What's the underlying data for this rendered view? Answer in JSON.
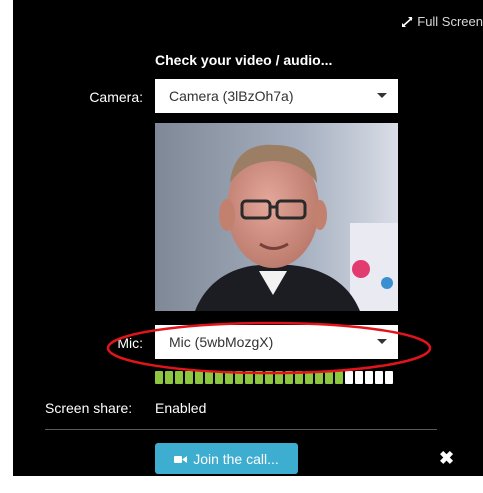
{
  "header": {
    "fullscreen_label": "Full Screen",
    "fullscreen_icon": "expand-arrows-icon"
  },
  "setup": {
    "heading": "Check your video / audio...",
    "camera": {
      "label": "Camera:",
      "selected": "Camera (3lBzOh7a)"
    },
    "mic": {
      "label": "Mic:",
      "selected": "Mic (5wbMozgX)"
    },
    "mic_level": {
      "active_bars": 19,
      "total_bars": 24,
      "active_color": "#8dc63f",
      "inactive_color": "#ffffff"
    },
    "screen_share": {
      "label": "Screen share:",
      "status": "Enabled"
    }
  },
  "footer": {
    "join_label": "Join the call...",
    "join_icon": "video-camera-icon",
    "close_icon": "close-icon"
  },
  "annotation": {
    "color": "#e2141b",
    "icon": "red-highlight-ellipse"
  }
}
